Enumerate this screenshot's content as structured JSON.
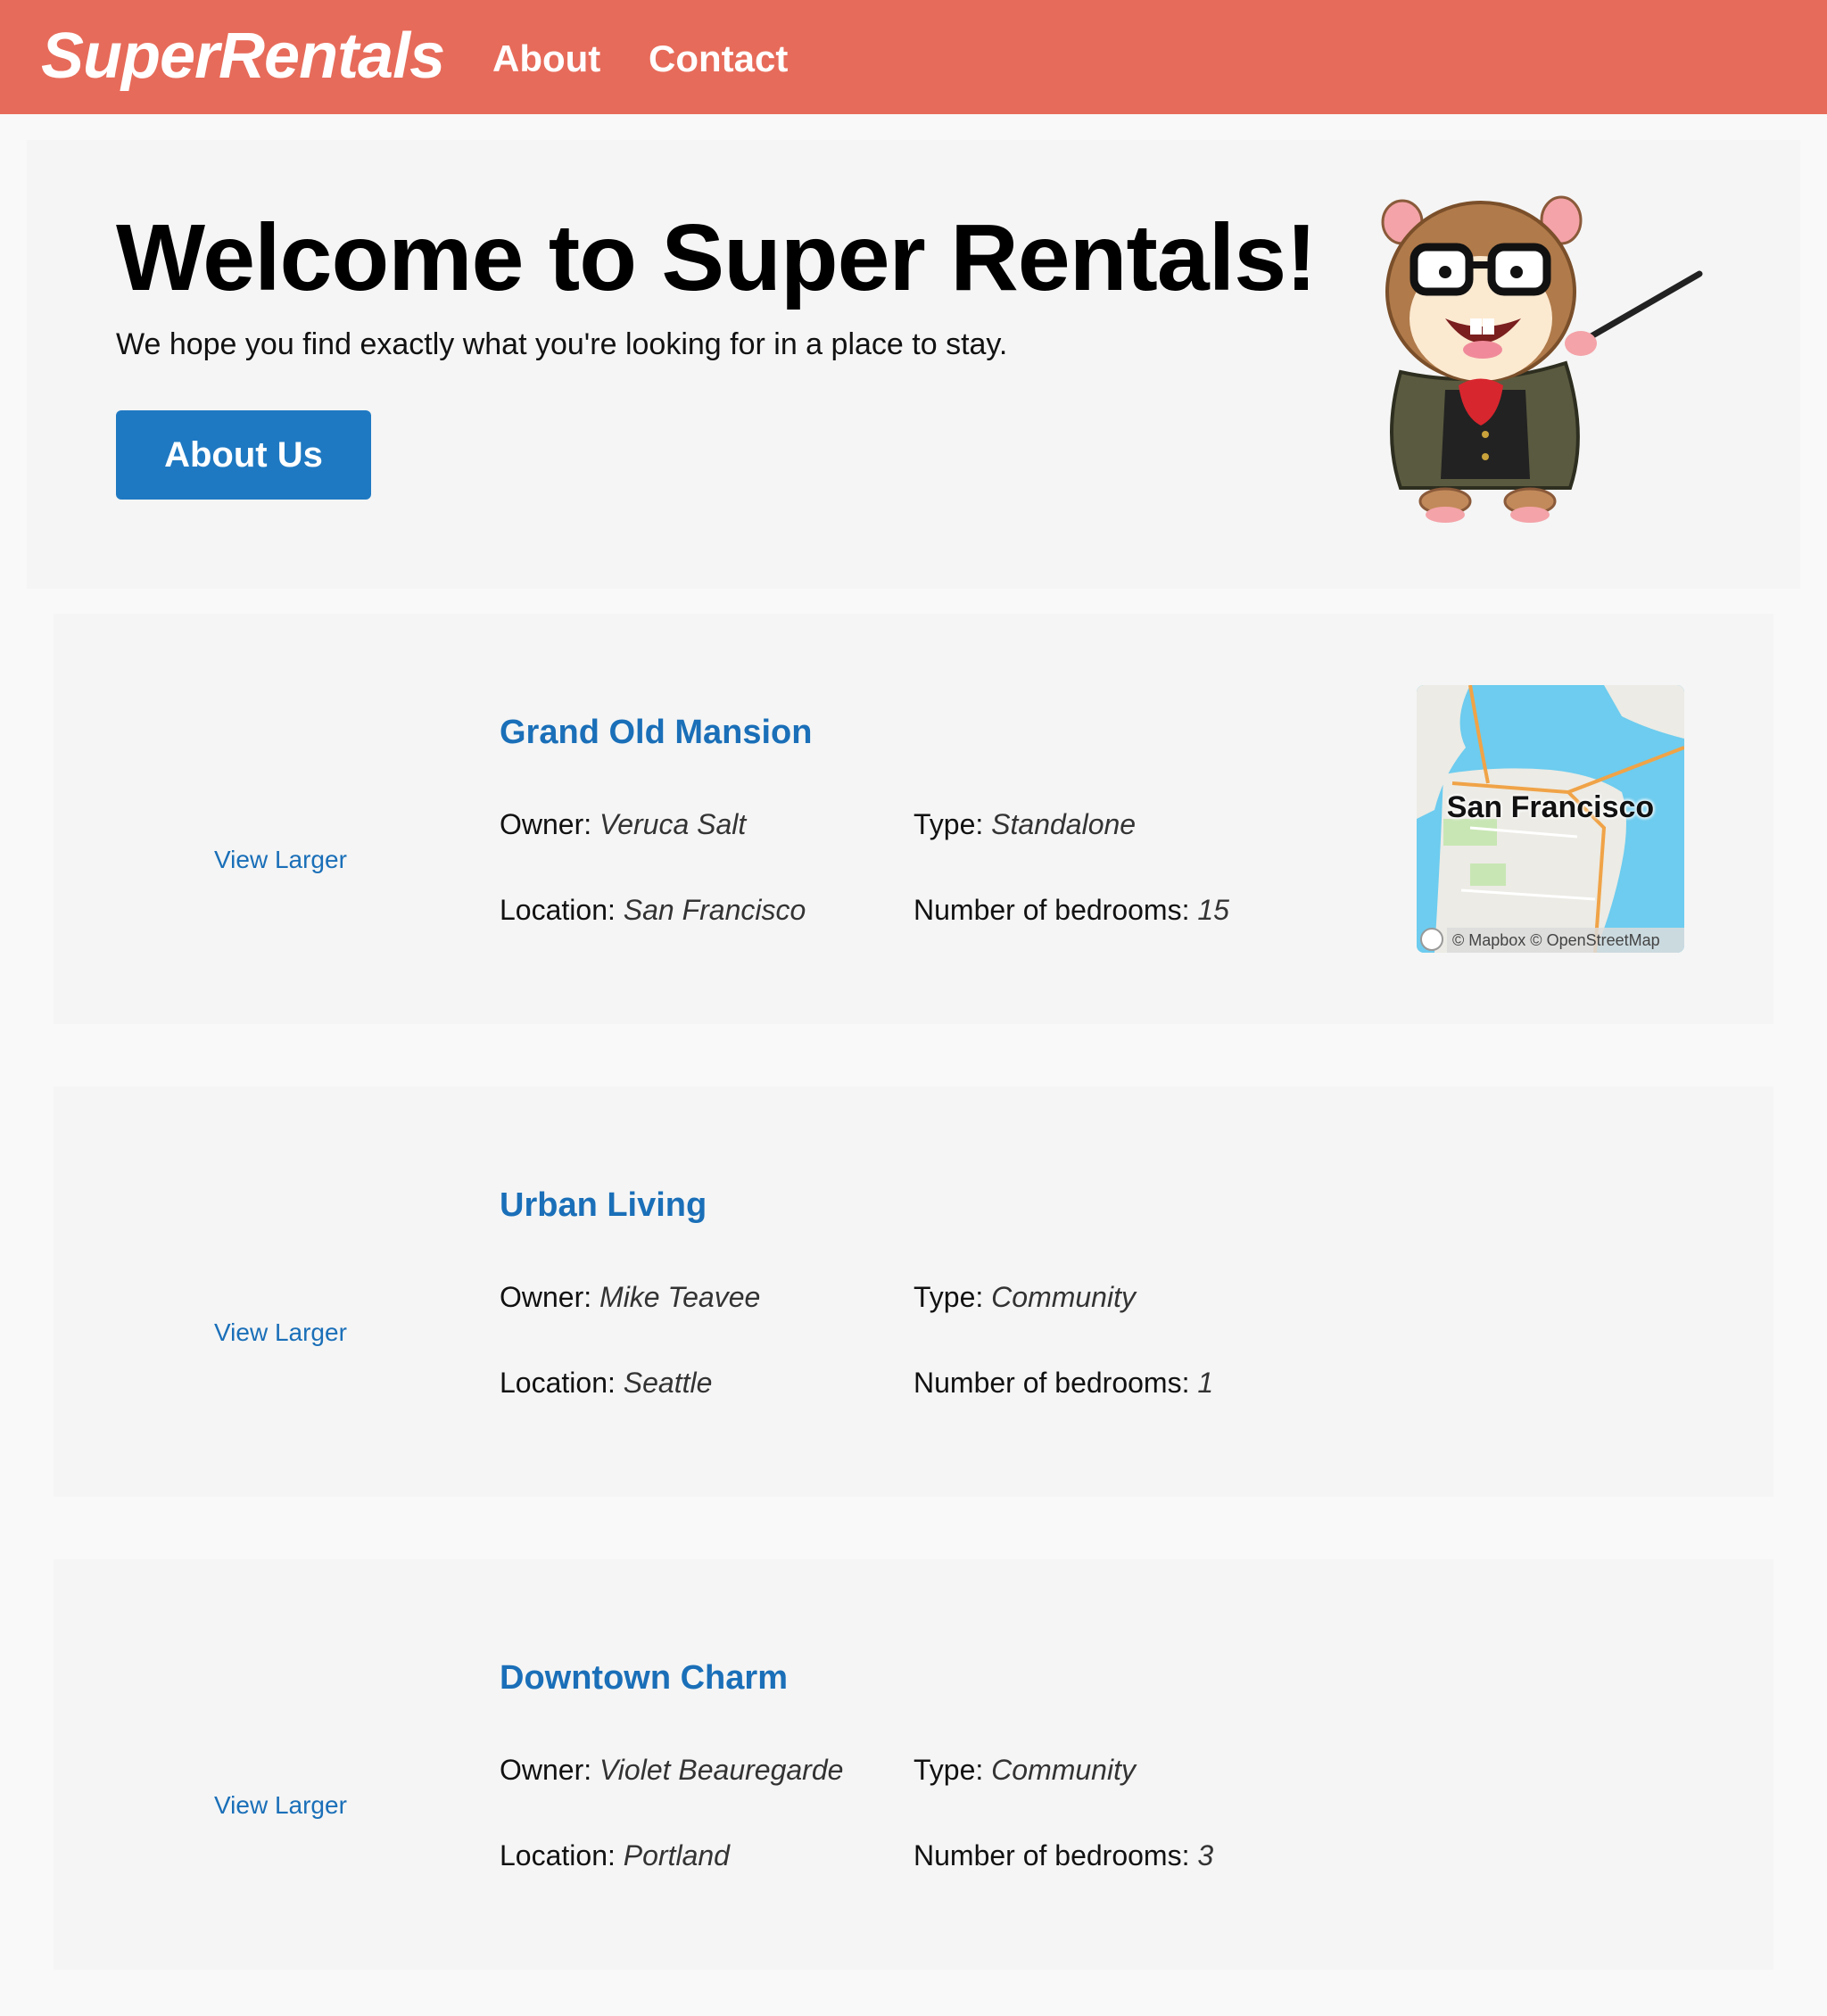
{
  "nav": {
    "brand": "SuperRentals",
    "about": "About",
    "contact": "Contact"
  },
  "jumbo": {
    "title": "Welcome to Super Rentals!",
    "subtitle": "We hope you find exactly what you're looking for in a place to stay.",
    "button": "About Us"
  },
  "labels": {
    "owner": "Owner:",
    "type": "Type:",
    "location": "Location:",
    "bedrooms": "Number of bedrooms:",
    "view_larger": "View Larger"
  },
  "rentals": [
    {
      "title": "Grand Old Mansion",
      "owner": "Veruca Salt",
      "type": "Standalone",
      "location": "San Francisco",
      "bedrooms": "15",
      "map": {
        "label": "San Francisco",
        "attribution": "© Mapbox © OpenStreetMap"
      }
    },
    {
      "title": "Urban Living",
      "owner": "Mike Teavee",
      "type": "Community",
      "location": "Seattle",
      "bedrooms": "1"
    },
    {
      "title": "Downtown Charm",
      "owner": "Violet Beauregarde",
      "type": "Community",
      "location": "Portland",
      "bedrooms": "3"
    }
  ],
  "colors": {
    "nav": "#e76b5a",
    "accent": "#1a6fb8",
    "button": "#1f79c2"
  }
}
